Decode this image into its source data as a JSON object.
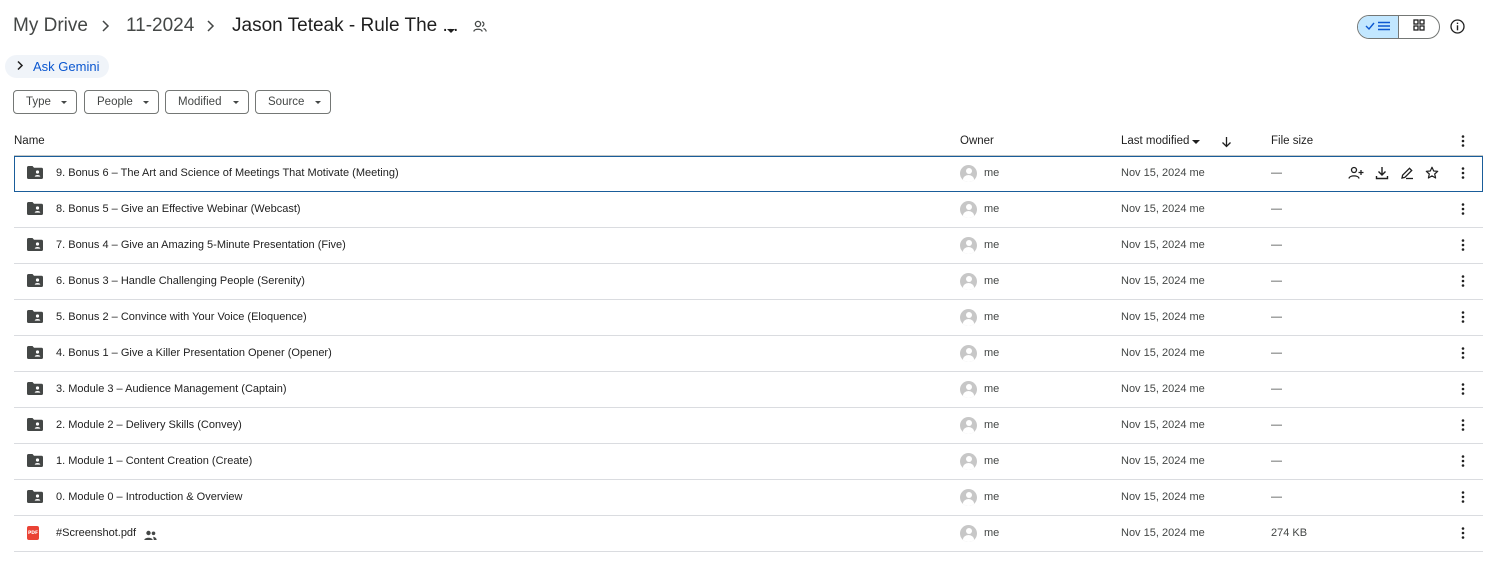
{
  "breadcrumb": {
    "root": "My Drive",
    "parent": "11-2024",
    "current": "Jason Teteak - Rule The ..."
  },
  "ask_gemini": "Ask Gemini",
  "filters": [
    {
      "label": "Type"
    },
    {
      "label": "People"
    },
    {
      "label": "Modified"
    },
    {
      "label": "Source"
    }
  ],
  "columns": {
    "name": "Name",
    "owner": "Owner",
    "last_modified": "Last modified",
    "file_size": "File size"
  },
  "rows": [
    {
      "name": "9. Bonus 6 – The Art and Science of Meetings That Motivate (Meeting)",
      "type": "shared-folder",
      "owner": "me",
      "modified": "Nov 15, 2024 me",
      "size": "—",
      "selected": true
    },
    {
      "name": "8. Bonus 5 – Give an Effective Webinar (Webcast)",
      "type": "shared-folder",
      "owner": "me",
      "modified": "Nov 15, 2024 me",
      "size": "—"
    },
    {
      "name": "7. Bonus 4 – Give an Amazing 5-Minute Presentation (Five)",
      "type": "shared-folder",
      "owner": "me",
      "modified": "Nov 15, 2024 me",
      "size": "—"
    },
    {
      "name": "6. Bonus 3 – Handle Challenging People (Serenity)",
      "type": "shared-folder",
      "owner": "me",
      "modified": "Nov 15, 2024 me",
      "size": "—"
    },
    {
      "name": "5. Bonus 2 – Convince with Your Voice (Eloquence)",
      "type": "shared-folder",
      "owner": "me",
      "modified": "Nov 15, 2024 me",
      "size": "—"
    },
    {
      "name": "4. Bonus 1 – Give a Killer Presentation Opener (Opener)",
      "type": "shared-folder",
      "owner": "me",
      "modified": "Nov 15, 2024 me",
      "size": "—"
    },
    {
      "name": "3. Module 3 – Audience Management (Captain)",
      "type": "shared-folder",
      "owner": "me",
      "modified": "Nov 15, 2024 me",
      "size": "—"
    },
    {
      "name": "2. Module 2 – Delivery Skills (Convey)",
      "type": "shared-folder",
      "owner": "me",
      "modified": "Nov 15, 2024 me",
      "size": "—"
    },
    {
      "name": "1. Module 1 – Content Creation (Create)",
      "type": "shared-folder",
      "owner": "me",
      "modified": "Nov 15, 2024 me",
      "size": "—"
    },
    {
      "name": "0. Module 0 – Introduction & Overview",
      "type": "shared-folder",
      "owner": "me",
      "modified": "Nov 15, 2024 me",
      "size": "—"
    },
    {
      "name": "#Screenshot.pdf",
      "type": "pdf",
      "owner": "me",
      "modified": "Nov 15, 2024 me",
      "size": "274 KB",
      "shared": true
    }
  ],
  "pdf_badge": "PDF",
  "colors": {
    "accent": "#0b57d0",
    "toggle_active": "#c2e7ff",
    "selected_border": "#1a5d9a",
    "pdf_red": "#ea4335"
  },
  "icons": {
    "header": [
      "chevron-right-icon",
      "caret-down-icon",
      "shared-people-icon",
      "checkmark-icon",
      "list-view-icon",
      "grid-view-icon",
      "info-icon"
    ],
    "row_actions": [
      "share-icon",
      "download-icon",
      "rename-icon",
      "star-icon"
    ],
    "row_more": "more-vert-icon"
  }
}
